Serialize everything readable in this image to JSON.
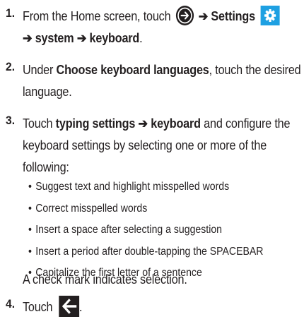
{
  "steps": [
    {
      "number": "1.",
      "text_a": "From the Home screen, touch",
      "arrow_1": "➔",
      "settings": "Settings",
      "arrow_2": "➔",
      "system": "system",
      "arrow_3": "➔",
      "keyboard": "keyboard",
      "period": "."
    },
    {
      "number": "2.",
      "text_a": "Under",
      "choose": "Choose keyboard languages",
      "text_b": ", touch the desired",
      "text_c": "language."
    },
    {
      "number": "3.",
      "text_a": "Touch",
      "typing": "typing settings",
      "arrow": "➔",
      "keyboard": "keyboard",
      "text_b": "and configure the",
      "text_c": "keyboard settings by selecting one or more of the",
      "text_d": "following:",
      "bullet_char": "•",
      "options": [
        "Suggest text and highlight misspelled words",
        "Correct misspelled words",
        "Insert a space after selecting a suggestion",
        "Insert a period after double-tapping the SPACEBAR",
        "Capitalize the first letter of a sentence"
      ],
      "note": "A check mark indicates selection."
    },
    {
      "number": "4.",
      "text_a": "Touch",
      "period": "."
    }
  ],
  "icons": {
    "start_arrow": "arrow-right-circle-icon",
    "settings_gear": "gear-icon",
    "back": "back-arrow-icon"
  },
  "colors": {
    "text": "#231f20",
    "gear_tile": "#1ea0e2"
  }
}
